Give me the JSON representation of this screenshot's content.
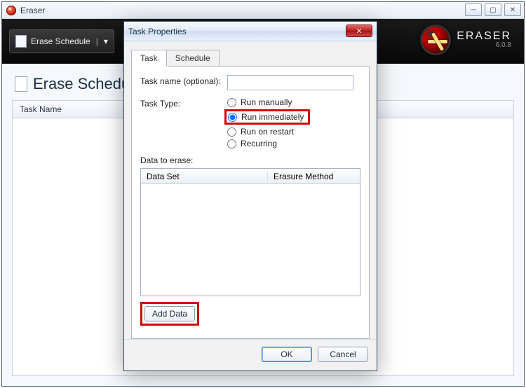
{
  "app": {
    "title": "Eraser",
    "brand_name": "ERASER",
    "version": "6.0.8"
  },
  "ribbon": {
    "schedule_button": "Erase Schedule",
    "dropdown_glyph": "▾"
  },
  "main": {
    "page_title": "Erase Schedule",
    "grid_header": "Task Name"
  },
  "dialog": {
    "title": "Task Properties",
    "tabs": {
      "task": "Task",
      "schedule": "Schedule"
    },
    "task_name_label": "Task name (optional):",
    "task_name_value": "",
    "task_type_label": "Task Type:",
    "radios": {
      "manually": "Run manually",
      "immediately": "Run immediately",
      "restart": "Run on restart",
      "recurring": "Recurring"
    },
    "selected_radio": "immediately",
    "data_section_label": "Data to erase:",
    "table": {
      "col1": "Data Set",
      "col2": "Erasure Method"
    },
    "add_data": "Add Data",
    "ok": "OK",
    "cancel": "Cancel"
  },
  "win_controls": {
    "min": "─",
    "max": "▢",
    "close": "✕"
  }
}
